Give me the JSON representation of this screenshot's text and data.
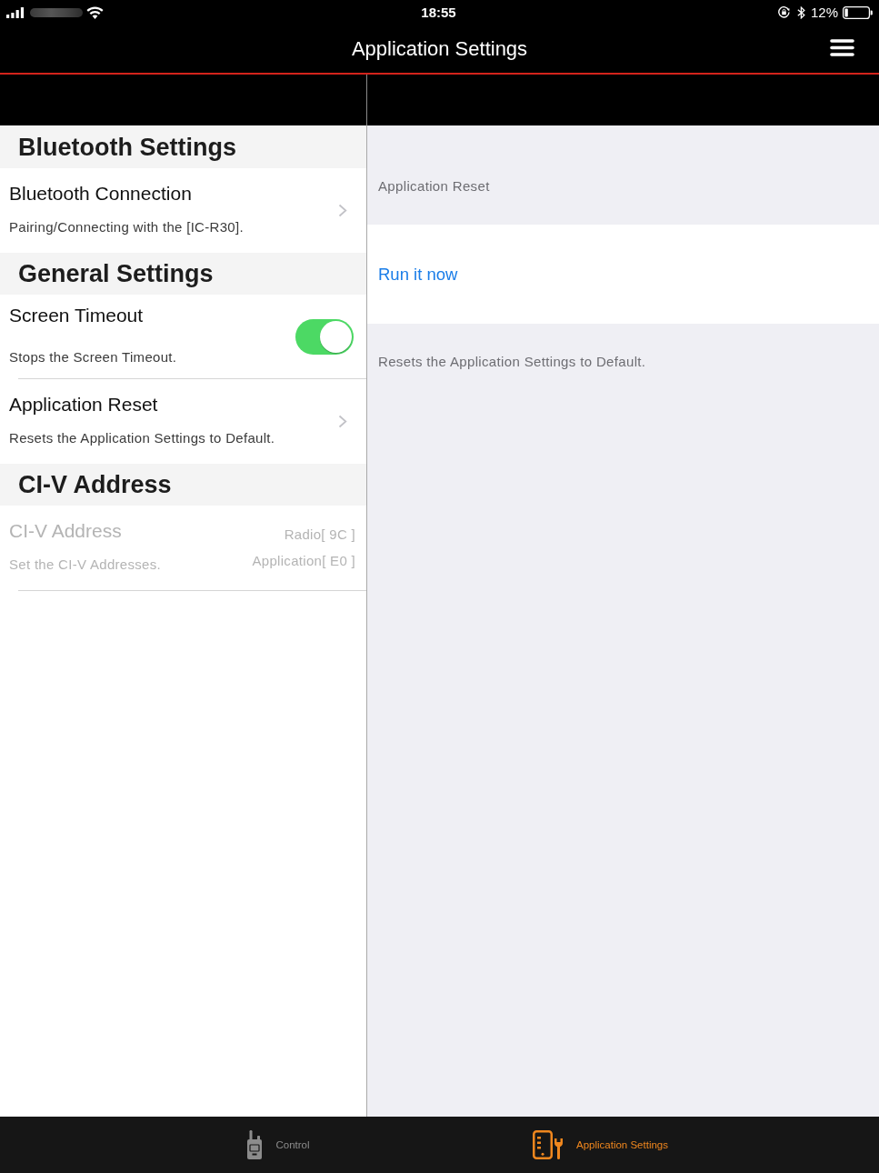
{
  "status_bar": {
    "time": "18:55",
    "battery": "12%"
  },
  "nav_bar": {
    "title": "Application Settings"
  },
  "settings": {
    "sections": [
      {
        "header": "Bluetooth Settings",
        "rows": [
          {
            "kind": "link",
            "title": "Bluetooth Connection",
            "subtitle": "Pairing/Connecting with the [IC-R30].",
            "disabled": false
          }
        ]
      },
      {
        "header": "General Settings",
        "rows": [
          {
            "kind": "toggle",
            "title": "Screen Timeout",
            "subtitle": "Stops the Screen Timeout.",
            "on": true,
            "disabled": false
          },
          {
            "kind": "link",
            "title": "Application Reset",
            "subtitle": "Resets the Application Settings to Default.",
            "disabled": false
          }
        ]
      },
      {
        "header": "CI-V Address",
        "rows": [
          {
            "kind": "values",
            "title": "CI-V Address",
            "subtitle": "Set the CI-V Addresses.",
            "values": [
              "Radio[ 9C ]",
              "Application[ E0 ]"
            ],
            "disabled": true
          }
        ]
      }
    ]
  },
  "detail": {
    "header": "Application Reset",
    "action": "Run it now",
    "footer": "Resets the Application Settings to Default."
  },
  "tab_bar": {
    "tabs": [
      {
        "label": "Control",
        "selected": false
      },
      {
        "label": "Application Settings",
        "selected": true
      }
    ]
  }
}
